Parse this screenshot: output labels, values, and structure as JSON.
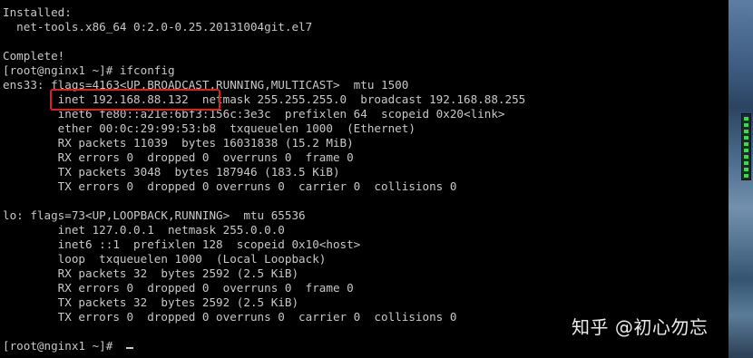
{
  "terminal": {
    "lines": [
      "Installed:",
      "  net-tools.x86_64 0:2.0-0.25.20131004git.el7",
      "",
      "Complete!",
      "[root@nginx1 ~]# ifconfig",
      "ens33: flags=4163<UP,BROADCAST,RUNNING,MULTICAST>  mtu 1500",
      "        inet 192.168.88.132  netmask 255.255.255.0  broadcast 192.168.88.255",
      "        inet6 fe80::a21e:6bf3:156c:3e3c  prefixlen 64  scopeid 0x20<link>",
      "        ether 00:0c:29:99:53:b8  txqueuelen 1000  (Ethernet)",
      "        RX packets 11039  bytes 16031838 (15.2 MiB)",
      "        RX errors 0  dropped 0  overruns 0  frame 0",
      "        TX packets 3048  bytes 187946 (183.5 KiB)",
      "        TX errors 0  dropped 0 overruns 0  carrier 0  collisions 0",
      "",
      "lo: flags=73<UP,LOOPBACK,RUNNING>  mtu 65536",
      "        inet 127.0.0.1  netmask 255.0.0.0",
      "        inet6 ::1  prefixlen 128  scopeid 0x10<host>",
      "        loop  txqueuelen 1000  (Local Loopback)",
      "        RX packets 32  bytes 2592 (2.5 KiB)",
      "        RX errors 0  dropped 0  overruns 0  frame 0",
      "        TX packets 32  bytes 2592 (2.5 KiB)",
      "        TX errors 0  dropped 0 overruns 0  carrier 0  collisions 0",
      "",
      "[root@nginx1 ~]# "
    ]
  },
  "colors": {
    "background": "#000000",
    "text": "#c8c8c8",
    "highlight": "#e02020"
  },
  "watermark": "知乎 @初心勿忘"
}
